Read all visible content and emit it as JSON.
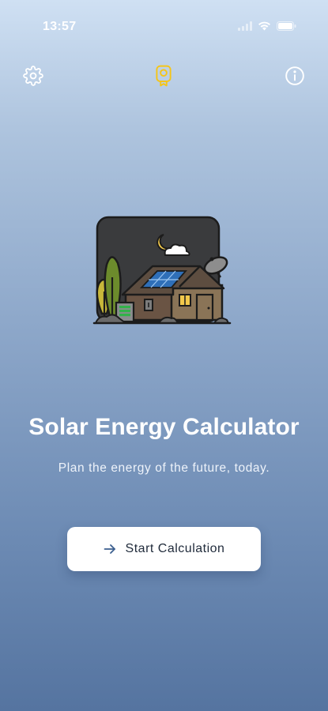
{
  "status_bar": {
    "time": "13:57",
    "icons": [
      "signal-icon",
      "wifi-icon",
      "battery-icon"
    ]
  },
  "toolbar": {
    "left_icon": "gear-icon",
    "center_icon": "award-badge-icon",
    "right_icon": "info-icon",
    "accent_color": "#f5c518"
  },
  "hero": {
    "illustration": "solar-house-night-illustration"
  },
  "main": {
    "title": "Solar Energy Calculator",
    "subtitle": "Plan the energy of the future, today.",
    "start_button_label": "Start Calculation",
    "start_button_icon": "arrow-right-icon"
  },
  "colors": {
    "background_top": "#cfe0f3",
    "background_bottom": "#5574a0",
    "button_bg": "#ffffff",
    "button_text": "#1f2a3a",
    "arrow": "#3b5f8f"
  }
}
